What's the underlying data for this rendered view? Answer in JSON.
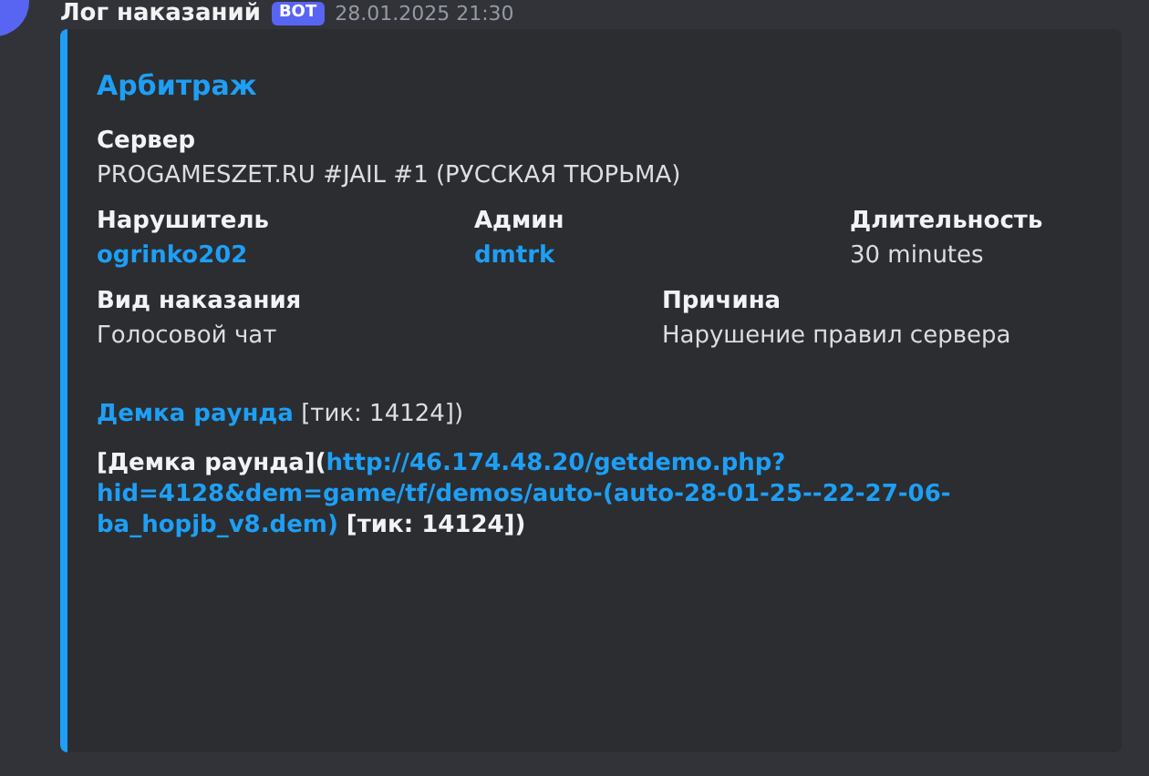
{
  "message": {
    "author": "Лог наказаний",
    "badge": "BOT",
    "timestamp": "28.01.2025 21:30"
  },
  "embed": {
    "title": "Арбитраж",
    "field_rows": [
      [
        {
          "name": "Сервер",
          "value": "PROGAMESZET.RU #JAIL #1 (РУССКАЯ ТЮРЬМА)",
          "kind": "text"
        }
      ],
      [
        {
          "name": "Нарушитель",
          "value": "ogrinko202",
          "kind": "link"
        },
        {
          "name": "Админ",
          "value": "dmtrk",
          "kind": "link"
        },
        {
          "name": "Длительность",
          "value": "30 minutes",
          "kind": "text"
        }
      ],
      [
        {
          "name": "Вид наказания",
          "value": "Голосовой чат",
          "kind": "text"
        },
        {
          "name": "Причина",
          "value": "Нарушение правил сервера",
          "kind": "text"
        }
      ]
    ],
    "description": [
      {
        "lines": [
          [
            {
              "kind": "link",
              "text": "Демка раунда"
            },
            {
              "kind": "text",
              "text": " [тик: 14124])"
            }
          ]
        ]
      },
      {
        "lines": [
          [
            {
              "kind": "bold",
              "text": "[Демка раунда]("
            },
            {
              "kind": "link",
              "text": "http://46.174.48.20/getdemo.php?"
            }
          ],
          [
            {
              "kind": "link",
              "text": "hid=4128&dem=game/tf/demos/auto-(auto-28-01-25--22-27-06-"
            }
          ],
          [
            {
              "kind": "link",
              "text": "ba_hopjb_v8.dem)"
            },
            {
              "kind": "bold",
              "text": " [тик: 14124])"
            }
          ]
        ]
      }
    ]
  }
}
